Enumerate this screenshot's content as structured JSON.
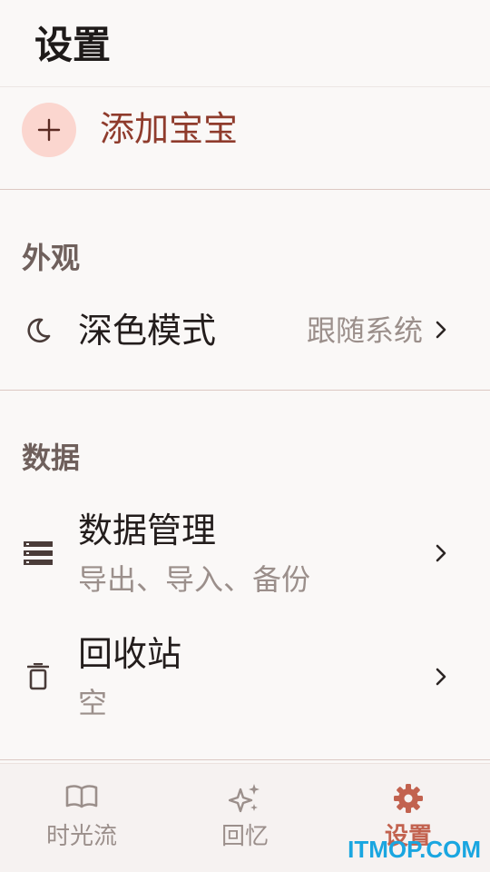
{
  "header": {
    "title": "设置"
  },
  "add_baby": {
    "label": "添加宝宝"
  },
  "appearance": {
    "section_title": "外观",
    "dark_mode": {
      "title": "深色模式",
      "value": "跟随系统"
    }
  },
  "data": {
    "section_title": "数据",
    "data_management": {
      "title": "数据管理",
      "subtitle": "导出、导入、备份"
    },
    "recycle_bin": {
      "title": "回收站",
      "subtitle": "空"
    }
  },
  "nav": {
    "items": [
      {
        "label": "时光流",
        "icon": "book-open-icon"
      },
      {
        "label": "回忆",
        "icon": "sparkles-icon"
      },
      {
        "label": "设置",
        "icon": "gear-icon",
        "active": true
      }
    ]
  },
  "watermark": "ITMOP.COM",
  "colors": {
    "accent": "#c2624f",
    "add_circle": "#fbd6cf",
    "add_text": "#8f3b2c",
    "background": "#faf8f7",
    "muted_text": "#9b8f8b"
  }
}
